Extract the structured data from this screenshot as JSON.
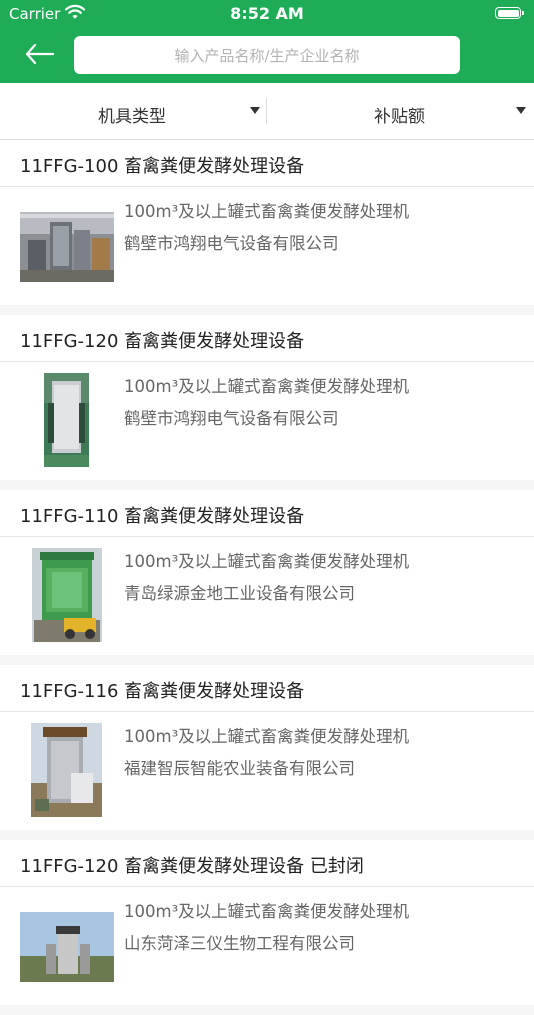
{
  "status": {
    "carrier": "Carrier",
    "time": "8:52 AM"
  },
  "search": {
    "placeholder": "输入产品名称/生产企业名称"
  },
  "filters": {
    "type_label": "机具类型",
    "subsidy_label": "补贴额"
  },
  "items": [
    {
      "title": "11FFG-100 畜禽粪便发酵处理设备",
      "desc": "100m³及以上罐式畜禽粪便发酵处理机",
      "company": "鹤壁市鸿翔电气设备有限公司"
    },
    {
      "title": "11FFG-120 畜禽粪便发酵处理设备",
      "desc": "100m³及以上罐式畜禽粪便发酵处理机",
      "company": "鹤壁市鸿翔电气设备有限公司"
    },
    {
      "title": "11FFG-110 畜禽粪便发酵处理设备",
      "desc": "100m³及以上罐式畜禽粪便发酵处理机",
      "company": "青岛绿源金地工业设备有限公司"
    },
    {
      "title": "11FFG-116 畜禽粪便发酵处理设备",
      "desc": "100m³及以上罐式畜禽粪便发酵处理机",
      "company": "福建智辰智能农业装备有限公司"
    },
    {
      "title": "11FFG-120 畜禽粪便发酵处理设备 已封闭",
      "desc": "100m³及以上罐式畜禽粪便发酵处理机",
      "company": "山东菏泽三仪生物工程有限公司"
    }
  ],
  "colors": {
    "header": "#1fac57",
    "text_primary": "#222222",
    "text_secondary": "#666666",
    "placeholder": "#b3b3b3"
  },
  "icons": {
    "back": "back-arrow-icon",
    "wifi": "wifi-icon",
    "battery": "battery-icon",
    "dropdown": "caret-down-icon"
  }
}
